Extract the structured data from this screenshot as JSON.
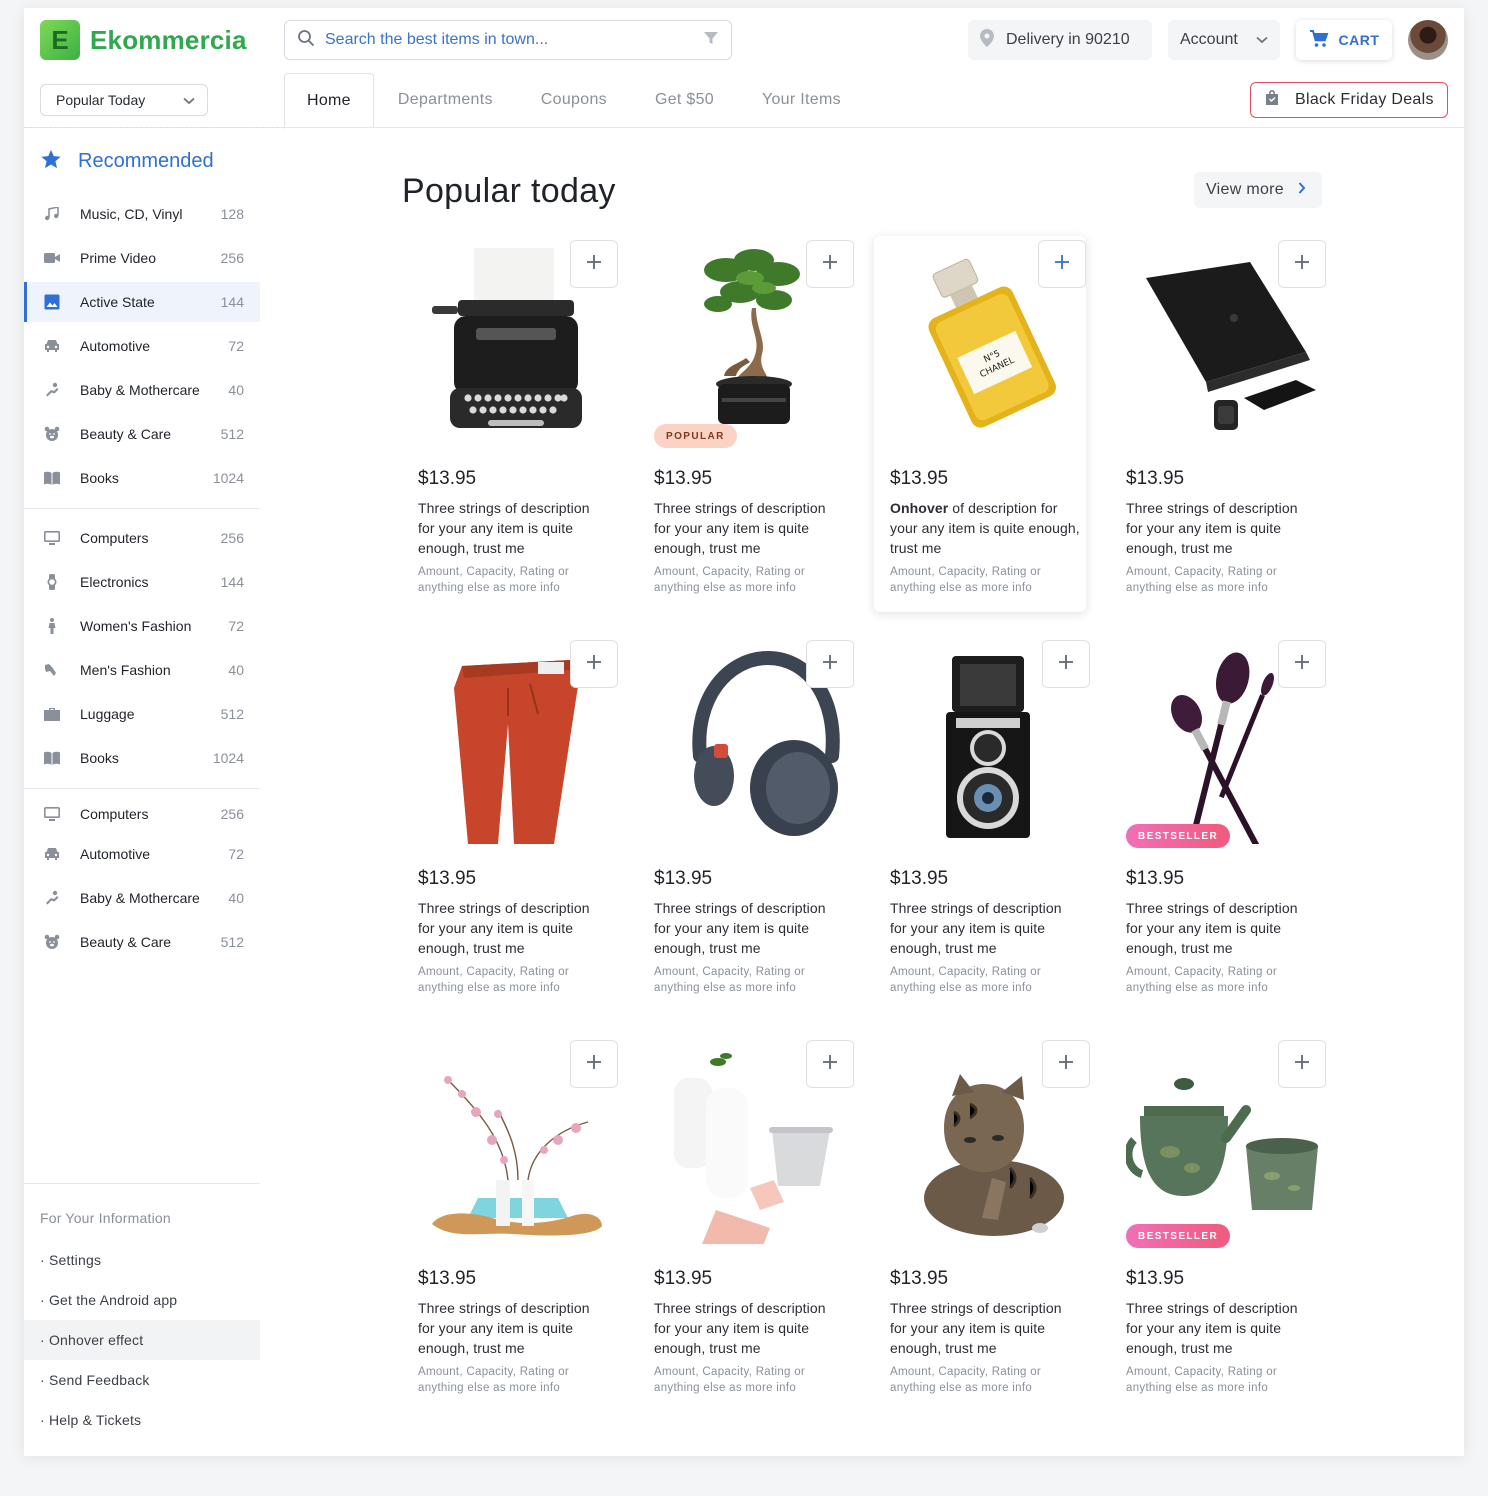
{
  "header": {
    "logo_letter": "E",
    "logo_text": "Ekommercia",
    "search_placeholder": "Search the best items in town...",
    "delivery": "Delivery in 90210",
    "account": "Account",
    "cart": "CART",
    "popular_dropdown": "Popular Today",
    "black_friday": "Black Friday Deals"
  },
  "tabs": [
    {
      "label": "Home",
      "active": true
    },
    {
      "label": "Departments"
    },
    {
      "label": "Coupons"
    },
    {
      "label": "Get $50"
    },
    {
      "label": "Your Items"
    }
  ],
  "sidebar": {
    "heading": "Recommended",
    "groups": [
      [
        {
          "label": "Music, CD, Vinyl",
          "count": "128",
          "icon": "music-icon"
        },
        {
          "label": "Prime Video",
          "count": "256",
          "icon": "video-icon"
        },
        {
          "label": "Active State",
          "count": "144",
          "icon": "image-icon",
          "active": true
        },
        {
          "label": "Automotive",
          "count": "72",
          "icon": "car-icon"
        },
        {
          "label": "Baby & Mothercare",
          "count": "40",
          "icon": "baby-icon"
        },
        {
          "label": "Beauty & Care",
          "count": "512",
          "icon": "bear-icon"
        },
        {
          "label": "Books",
          "count": "1024",
          "icon": "book-icon"
        }
      ],
      [
        {
          "label": "Computers",
          "count": "256",
          "icon": "monitor-icon"
        },
        {
          "label": "Electronics",
          "count": "144",
          "icon": "watch-icon"
        },
        {
          "label": "Women's Fashion",
          "count": "72",
          "icon": "person-icon"
        },
        {
          "label": "Men's Fashion",
          "count": "40",
          "icon": "hanger-icon"
        },
        {
          "label": "Luggage",
          "count": "512",
          "icon": "briefcase-icon"
        },
        {
          "label": "Books",
          "count": "1024",
          "icon": "book-icon"
        }
      ],
      [
        {
          "label": "Computers",
          "count": "256",
          "icon": "monitor-icon"
        },
        {
          "label": "Automotive",
          "count": "72",
          "icon": "car-icon"
        },
        {
          "label": "Baby & Mothercare",
          "count": "40",
          "icon": "baby-icon"
        },
        {
          "label": "Beauty & Care",
          "count": "512",
          "icon": "bear-icon"
        }
      ]
    ],
    "info_heading": "For Your Information",
    "info_items": [
      {
        "label": "· Settings"
      },
      {
        "label": "· Get the Android app"
      },
      {
        "label": "· Onhover effect",
        "hover": true
      },
      {
        "label": "· Send Feedback"
      },
      {
        "label": "· Help & Tickets"
      }
    ]
  },
  "main": {
    "title": "Popular today",
    "view_more": "View more"
  },
  "products": [
    {
      "price": "$13.95",
      "image": "typewriter",
      "desc_lead": "",
      "desc": "Three strings of description for your any item is quite enough, trust me",
      "meta": "Amount, Capacity, Rating or anything else as more info"
    },
    {
      "price": "$13.95",
      "image": "bonsai",
      "badge": "POPULAR",
      "badge_type": "popular",
      "desc_lead": "",
      "desc": "Three strings of description for your any item is quite enough, trust me",
      "meta": "Amount, Capacity, Rating or anything else as more info"
    },
    {
      "price": "$13.95",
      "image": "perfume",
      "hover": true,
      "desc_lead": "Onhover",
      "desc": " of description for your any item is quite enough, trust me",
      "meta": "Amount, Capacity, Rating or anything else as more info"
    },
    {
      "price": "$13.95",
      "image": "laptop",
      "desc_lead": "",
      "desc": "Three strings of description for your any item is quite enough, trust me",
      "meta": "Amount, Capacity, Rating or anything else as more info"
    },
    {
      "price": "$13.95",
      "image": "pants",
      "desc_lead": "",
      "desc": "Three strings of description for your any item is quite enough, trust me",
      "meta": "Amount, Capacity, Rating or anything else as more info"
    },
    {
      "price": "$13.95",
      "image": "headphones",
      "desc_lead": "",
      "desc": "Three strings of description for your any item is quite enough, trust me",
      "meta": "Amount, Capacity, Rating or anything else as more info"
    },
    {
      "price": "$13.95",
      "image": "camera",
      "desc_lead": "",
      "desc": "Three strings of description for your any item is quite enough, trust me",
      "meta": "Amount, Capacity, Rating or anything else as more info"
    },
    {
      "price": "$13.95",
      "image": "brushes",
      "badge": "BESTSELLER",
      "badge_type": "best",
      "desc_lead": "",
      "desc": "Three strings of description for your any item is quite enough, trust me",
      "meta": "Amount, Capacity, Rating or anything else as more info"
    },
    {
      "price": "$13.95",
      "image": "vases",
      "desc_lead": "",
      "desc": "Three strings of description for your any item is quite enough, trust me",
      "meta": "Amount, Capacity, Rating or anything else as more info"
    },
    {
      "price": "$13.95",
      "image": "ceramics",
      "desc_lead": "",
      "desc": "Three strings of description for your any item is quite enough, trust me",
      "meta": "Amount, Capacity, Rating or anything else as more info"
    },
    {
      "price": "$13.95",
      "image": "cat",
      "desc_lead": "",
      "desc": "Three strings of description for your any item is quite enough, trust me",
      "meta": "Amount, Capacity, Rating or anything else as more info"
    },
    {
      "price": "$13.95",
      "image": "teapot",
      "badge": "BESTSELLER",
      "badge_type": "best",
      "desc_lead": "",
      "desc": "Three strings of description for your any item is quite enough, trust me",
      "meta": "Amount, Capacity, Rating or anything else as more info"
    }
  ],
  "colors": {
    "accent": "#2f6fd6",
    "brand": "#2fa84f",
    "black_friday_border": "#e44d5e",
    "popular_badge": "#fbd3c4",
    "bestseller_badge": "#f06fb6"
  }
}
